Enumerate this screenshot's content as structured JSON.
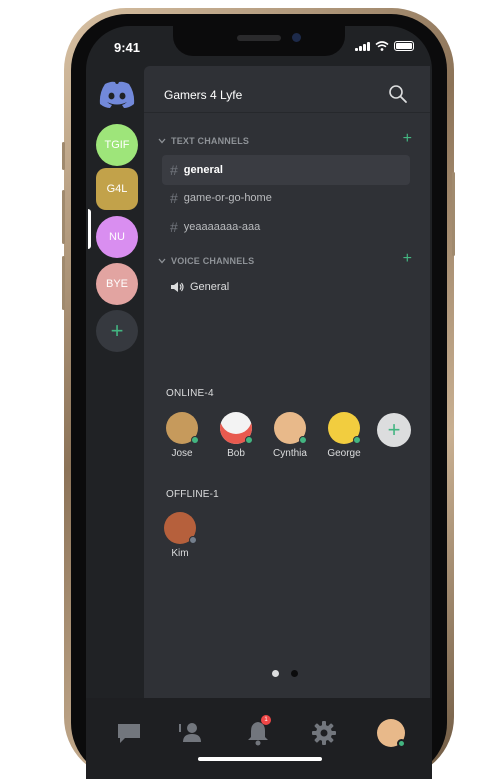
{
  "status_bar": {
    "time": "9:41"
  },
  "servers": [
    {
      "label": "",
      "icon": "discord-logo-icon",
      "color": "#7289da"
    },
    {
      "label": "TGIF",
      "color": "#9ee57a"
    },
    {
      "label": "G4L",
      "color": "#c2a24a",
      "active": true
    },
    {
      "label": "NU",
      "color": "#d98ef0"
    },
    {
      "label": "BYE",
      "color": "#e2a4a1"
    },
    {
      "label": "+",
      "icon": "add-server-icon",
      "color": "#43b581"
    }
  ],
  "server_name": "Gamers 4 Lyfe",
  "categories": {
    "text": "TEXT CHANNELS",
    "voice": "VOICE CHANNELS"
  },
  "text_channels": [
    "general",
    "game-or-go-home",
    "yeaaaaaaa-aaa"
  ],
  "voice_channels": [
    "General"
  ],
  "online_label": "ONLINE-4",
  "online_members": [
    {
      "name": "Jose",
      "color": "#c69a5c"
    },
    {
      "name": "Bob",
      "color": "#e85a4f"
    },
    {
      "name": "Cynthia",
      "color": "#e8b98a"
    },
    {
      "name": "George",
      "color": "#f2cd3f"
    }
  ],
  "offline_label": "OFFLINE-1",
  "offline_members": [
    {
      "name": "Kim",
      "color": "#b6603c"
    }
  ],
  "tabs": [
    {
      "icon": "chat-icon"
    },
    {
      "icon": "friends-icon"
    },
    {
      "icon": "bell-icon",
      "badge": "1"
    },
    {
      "icon": "gear-icon"
    },
    {
      "icon": "profile-avatar-icon"
    }
  ],
  "colors": {
    "accent_green": "#43b581",
    "blurple": "#7289da",
    "background": "#2f3136",
    "rail": "#202225"
  }
}
